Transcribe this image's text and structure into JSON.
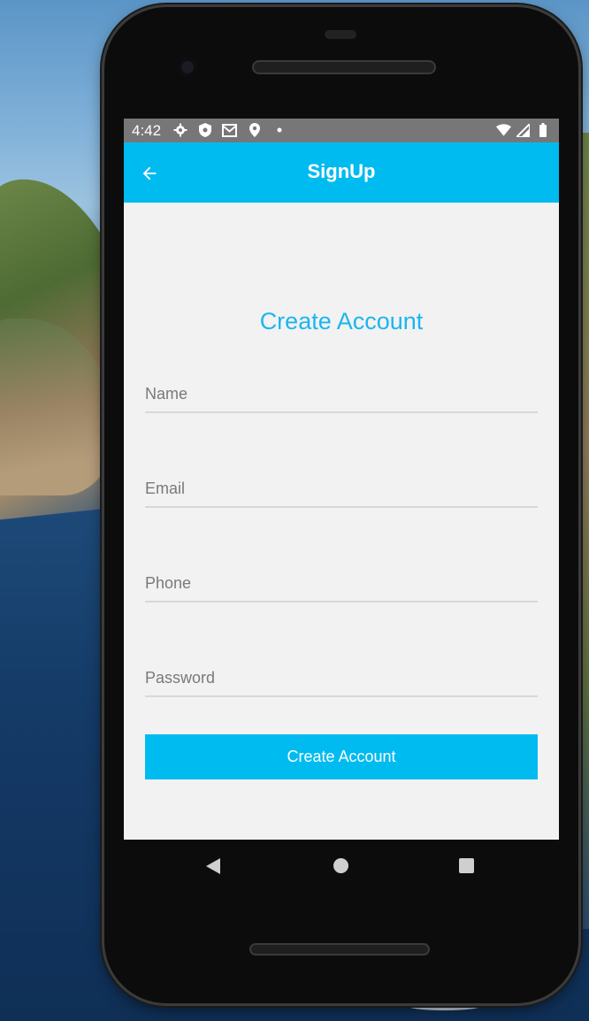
{
  "status_bar": {
    "time": "4:42",
    "icons_left": [
      "settings-icon",
      "shield-icon",
      "gmail-icon",
      "location-icon",
      "notification-dot-icon"
    ],
    "icons_right": [
      "wifi-icon",
      "signal-icon",
      "battery-icon"
    ]
  },
  "app_bar": {
    "title": "SignUp",
    "back_icon": "arrow-back-icon"
  },
  "form": {
    "heading": "Create Account",
    "name_placeholder": "Name",
    "email_placeholder": "Email",
    "phone_placeholder": "Phone",
    "password_placeholder": "Password",
    "submit_label": "Create Account"
  },
  "nav_bar": {
    "buttons": [
      "back-icon",
      "home-icon",
      "recents-icon"
    ]
  },
  "colors": {
    "accent": "#00bbf0",
    "heading_text": "#1cb6ef",
    "status_bar": "#777777",
    "screen_bg": "#f2f2f2"
  }
}
